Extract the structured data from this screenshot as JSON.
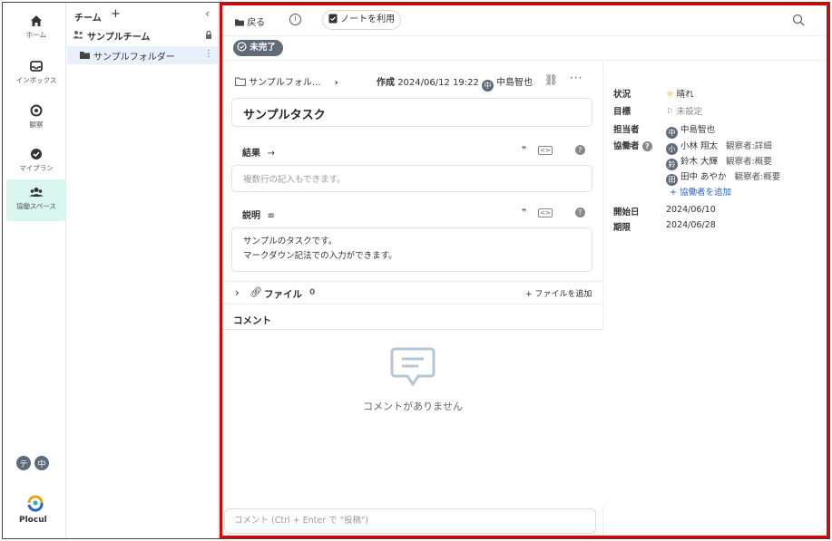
{
  "nav": {
    "items": [
      {
        "label": "ホーム",
        "icon": "home-icon"
      },
      {
        "label": "インボックス",
        "icon": "inbox-icon"
      },
      {
        "label": "観察",
        "icon": "eye-icon"
      },
      {
        "label": "マイプラン",
        "icon": "check-circle-icon"
      },
      {
        "label": "協働スペース",
        "icon": "team-icon"
      }
    ],
    "avatars": [
      "テ",
      "中"
    ],
    "logo_text": "Plocul"
  },
  "sidebar": {
    "header": "チーム",
    "add": "+",
    "team_name": "サンプルチーム",
    "folder_name": "サンプルフォルダー"
  },
  "toolbar": {
    "back_label": "戻る",
    "info": "i",
    "note_label": "ノートを利用"
  },
  "status": {
    "label": "未完了"
  },
  "task": {
    "breadcrumb": "サンプルフォル...",
    "created_label": "作成",
    "created_at": "2024/06/12 19:22",
    "creator_initial": "中",
    "creator": "中島智也",
    "title": "サンプルタスク",
    "result_label": "結果",
    "result_placeholder": "複数行の記入もできます。",
    "desc_label": "説明",
    "desc_line1": "サンプルのタスクです。",
    "desc_line2": "マークダウン記法での入力ができます。",
    "file_label": "ファイル",
    "file_count": "0",
    "add_file_label": "ファイルを追加",
    "comment_head": "コメント",
    "comment_empty": "コメントがありません",
    "comment_placeholder": "コメント (Ctrl + Enter で \"投稿\")"
  },
  "props": {
    "status_label": "状況",
    "status_value": "晴れ",
    "goal_label": "目標",
    "goal_value": "未設定",
    "assignee_label": "担当者",
    "assignee_initial": "中",
    "assignee": "中島智也",
    "collab_label": "協働者",
    "collaborators": [
      {
        "initial": "小",
        "name": "小林 翔太",
        "role": "観察者:詳細"
      },
      {
        "initial": "鈴",
        "name": "鈴木 大輝",
        "role": "観察者:概要"
      },
      {
        "initial": "田",
        "name": "田中 あやか",
        "role": "観察者:概要"
      }
    ],
    "add_collab": "協働者を追加",
    "start_label": "開始日",
    "start_value": "2024/06/10",
    "due_label": "期限",
    "due_value": "2024/06/28"
  },
  "colors": {
    "accent": "#d9f5ef",
    "status_chip": "#5f6b78",
    "highlight_border": "#e00000",
    "link": "#2563c9"
  }
}
